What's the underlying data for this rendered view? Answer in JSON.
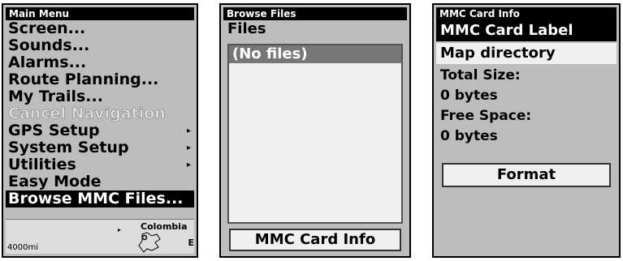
{
  "main_menu": {
    "title": "Main Menu",
    "items": [
      {
        "label": "Screen...",
        "state": "normal",
        "has_submenu": false
      },
      {
        "label": "Sounds...",
        "state": "normal",
        "has_submenu": false
      },
      {
        "label": "Alarms...",
        "state": "normal",
        "has_submenu": false
      },
      {
        "label": "Route Planning...",
        "state": "normal",
        "has_submenu": false
      },
      {
        "label": "My Trails...",
        "state": "normal",
        "has_submenu": false
      },
      {
        "label": "Cancel Navigation",
        "state": "disabled",
        "has_submenu": false
      },
      {
        "label": "GPS Setup",
        "state": "normal",
        "has_submenu": true
      },
      {
        "label": "System Setup",
        "state": "normal",
        "has_submenu": true
      },
      {
        "label": "Utilities",
        "state": "normal",
        "has_submenu": true
      },
      {
        "label": "Easy Mode",
        "state": "normal",
        "has_submenu": false
      },
      {
        "label": "Browse MMC Files...",
        "state": "selected",
        "has_submenu": false
      }
    ],
    "submenu_arrow": "▸",
    "map": {
      "scale": "4000mi",
      "country": "Colombia",
      "edge_label": "E",
      "pointer": "▸"
    }
  },
  "browse_files": {
    "title": "Browse Files",
    "section_label": "Files",
    "list_items": [
      "(No files)"
    ],
    "button_label": "MMC Card Info"
  },
  "mmc_card_info": {
    "title": "MMC Card Info",
    "card_label_header": "MMC Card Label",
    "card_label_value": "Map directory",
    "total_size_label": "Total Size:",
    "total_size_value": "0 bytes",
    "free_space_label": "Free Space:",
    "free_space_value": "0 bytes",
    "format_button": "Format"
  },
  "colors": {
    "screen_bg": "#bdbdbd",
    "highlight": "#000000",
    "list_highlight": "#777777",
    "field_bg": "#f0f0f0"
  }
}
